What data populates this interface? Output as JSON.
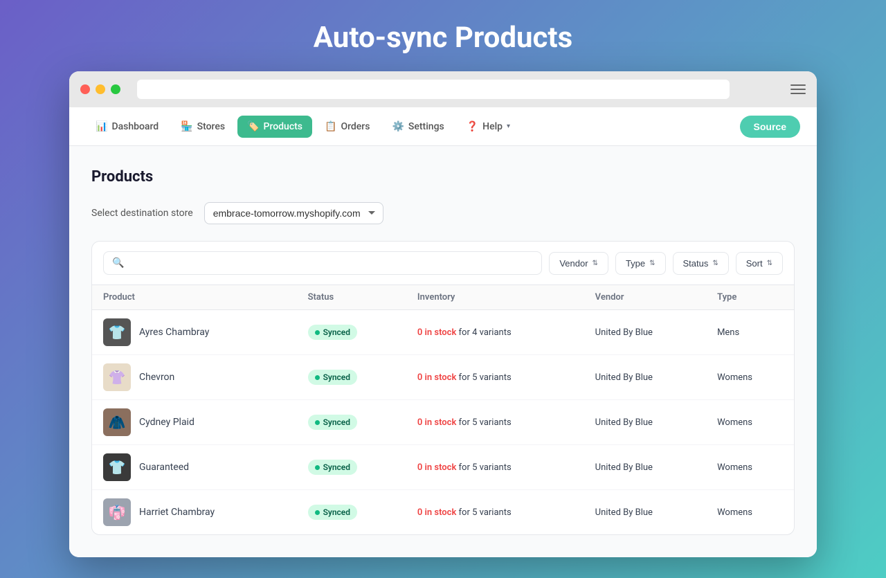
{
  "pageTitle": "Auto-sync Products",
  "browser": {
    "dots": [
      "red",
      "yellow",
      "green"
    ]
  },
  "nav": {
    "items": [
      {
        "label": "Dashboard",
        "icon": "📊",
        "active": false
      },
      {
        "label": "Stores",
        "icon": "🏪",
        "active": false
      },
      {
        "label": "Products",
        "icon": "🏷️",
        "active": true
      },
      {
        "label": "Orders",
        "icon": "📋",
        "active": false
      },
      {
        "label": "Settings",
        "icon": "⚙️",
        "active": false
      },
      {
        "label": "Help",
        "icon": "❓",
        "active": false,
        "hasChevron": true
      }
    ],
    "sourceButton": "Source"
  },
  "mainSection": {
    "title": "Products",
    "storeSelector": {
      "label": "Select destination store",
      "value": "embrace-tomorrow.myshopify.com"
    }
  },
  "toolbar": {
    "searchPlaceholder": "",
    "filters": [
      {
        "label": "Vendor",
        "id": "vendor-filter"
      },
      {
        "label": "Type",
        "id": "type-filter"
      },
      {
        "label": "Status",
        "id": "status-filter"
      },
      {
        "label": "Sort",
        "id": "sort-filter"
      }
    ]
  },
  "table": {
    "columns": [
      "Product",
      "Status",
      "Inventory",
      "Vendor",
      "Type"
    ],
    "rows": [
      {
        "id": 1,
        "name": "Ayres Chambray",
        "thumbStyle": "dark",
        "thumbEmoji": "👕",
        "status": "Synced",
        "inventoryZero": "0 in stock",
        "inventoryRest": " for 4 variants",
        "vendor": "United By Blue",
        "type": "Mens"
      },
      {
        "id": 2,
        "name": "Chevron",
        "thumbStyle": "light-beige",
        "thumbEmoji": "👚",
        "status": "Synced",
        "inventoryZero": "0 in stock",
        "inventoryRest": " for 5 variants",
        "vendor": "United By Blue",
        "type": "Womens"
      },
      {
        "id": 3,
        "name": "Cydney Plaid",
        "thumbStyle": "plaid",
        "thumbEmoji": "🧥",
        "status": "Synced",
        "inventoryZero": "0 in stock",
        "inventoryRest": " for 5 variants",
        "vendor": "United By Blue",
        "type": "Womens"
      },
      {
        "id": 4,
        "name": "Guaranteed",
        "thumbStyle": "dark-shirt",
        "thumbEmoji": "👕",
        "status": "Synced",
        "inventoryZero": "0 in stock",
        "inventoryRest": " for 5 variants",
        "vendor": "United By Blue",
        "type": "Womens"
      },
      {
        "id": 5,
        "name": "Harriet Chambray",
        "thumbStyle": "gray-shirt",
        "thumbEmoji": "👘",
        "status": "Synced",
        "inventoryZero": "0 in stock",
        "inventoryRest": " for 5 variants",
        "vendor": "United By Blue",
        "type": "Womens"
      }
    ]
  }
}
